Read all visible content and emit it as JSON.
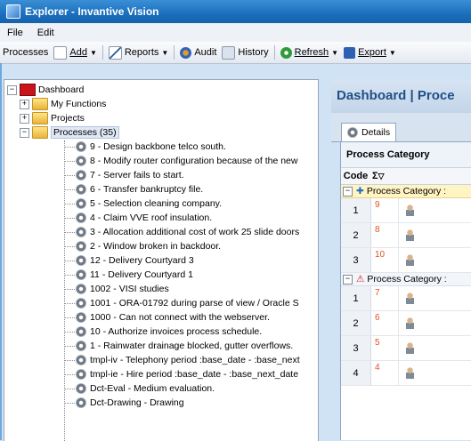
{
  "window": {
    "title": "Explorer - Invantive Vision"
  },
  "menu": [
    "File",
    "Edit"
  ],
  "toolbar": {
    "processes": "Processes",
    "add": "Add",
    "reports": "Reports",
    "audit": "Audit",
    "history": "History",
    "refresh": "Refresh",
    "export": "Export"
  },
  "tree": {
    "root": "Dashboard",
    "my_functions": "My Functions",
    "projects": "Projects",
    "processes": "Processes (35)",
    "items": [
      "9 - Design backbone telco south.",
      "8 - Modify router configuration because of the new",
      "7 - Server fails to start.",
      "6 - Transfer bankruptcy file.",
      "5 - Selection cleaning company.",
      "4 - Claim VVE roof insulation.",
      "3 - Allocation additional cost of work 25 slide doors",
      "2 - Window broken in backdoor.",
      "12 - Delivery Courtyard 3",
      "11 - Delivery Courtyard 1",
      "1002 - VISI studies",
      "1001 - ORA-01792 during parse of view / Oracle S",
      "1000 - Can not connect with the webserver.",
      "10 - Authorize invoices process schedule.",
      "1 - Rainwater drainage blocked, gutter overflows.",
      "tmpl-iv - Telephony period :base_date - :base_next",
      "tmpl-ie - Hire period :base_date - :base_next_date",
      "Dct-Eval - Medium evaluation.",
      "Dct-Drawing - Drawing"
    ]
  },
  "panel": {
    "title": "Dashboard | Proce",
    "tab": "Details",
    "group_by": "Process Category",
    "col_code": "Code",
    "col_sum": "Σ",
    "group1": "Process Category :",
    "group2": "Process Category :",
    "group1_rows": [
      {
        "code": "1",
        "val": "9"
      },
      {
        "code": "2",
        "val": "8"
      },
      {
        "code": "3",
        "val": "10"
      }
    ],
    "group2_rows": [
      {
        "code": "1",
        "val": "7"
      },
      {
        "code": "2",
        "val": "6"
      },
      {
        "code": "3",
        "val": "5"
      },
      {
        "code": "4",
        "val": "4"
      }
    ]
  },
  "colors": {
    "title_bar": "#1b6fbd",
    "value_text": "#e0531f",
    "warning": "#d21b1b"
  }
}
